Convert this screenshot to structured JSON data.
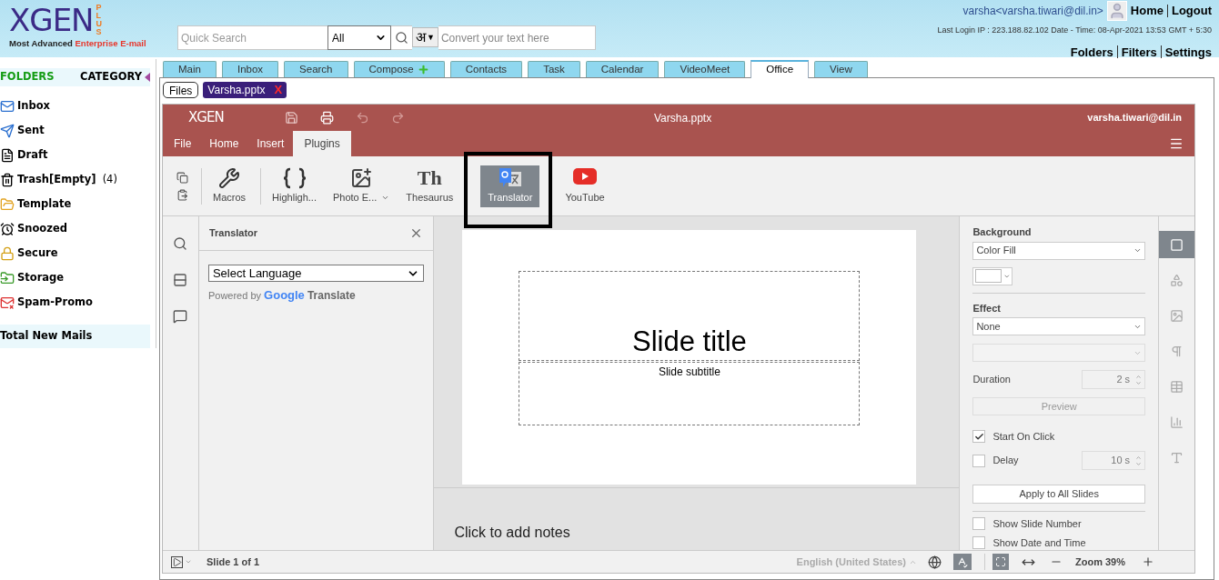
{
  "logo": {
    "name": "XGEN",
    "suffix": "PLUS",
    "tagline": "Most Advanced",
    "tagline_accent": "Enterprise E-mail"
  },
  "search": {
    "placeholder": "Quick Search",
    "scope": "All",
    "script_key": "अ",
    "script_caret": "▼",
    "convert_placeholder": "Convert your text here"
  },
  "user": {
    "identity": "varsha<varsha.tiwari@dil.in>",
    "links": [
      "Home",
      "Logout"
    ],
    "last_login": "Last Login IP : 223.188.82.102 Date - Time: 08-Apr-2021 13:53 GMT + 5:30",
    "nav": [
      "Folders",
      "Filters",
      "Settings"
    ]
  },
  "sidebar": {
    "folders_label": "FOLDERS",
    "category_label": "CATEGORY",
    "items": [
      {
        "kind": "inbox",
        "label": "Inbox"
      },
      {
        "kind": "sent",
        "label": "Sent"
      },
      {
        "kind": "draft",
        "label": "Draft"
      },
      {
        "kind": "trash",
        "label": "Trash[Empty]",
        "count": "(4)"
      },
      {
        "kind": "template",
        "label": "Template"
      },
      {
        "kind": "snoozed",
        "label": "Snoozed"
      },
      {
        "kind": "secure",
        "label": "Secure"
      },
      {
        "kind": "storage",
        "label": "Storage"
      },
      {
        "kind": "spam",
        "label": "Spam-Promo"
      }
    ],
    "total": "Total New Mails"
  },
  "tabs": [
    {
      "label": "Main",
      "selected": false
    },
    {
      "label": "Inbox",
      "selected": false
    },
    {
      "label": "Search",
      "selected": false
    },
    {
      "label": "Compose",
      "selected": false,
      "add": true
    },
    {
      "label": "Contacts",
      "selected": false
    },
    {
      "label": "Task",
      "selected": false
    },
    {
      "label": "Calendar",
      "selected": false
    },
    {
      "label": "VideoMeet",
      "selected": false
    },
    {
      "label": "Office",
      "selected": true
    },
    {
      "label": "View",
      "selected": false
    }
  ],
  "files": {
    "button": "Files",
    "open_file": "Varsha.pptx",
    "close": "X"
  },
  "editor": {
    "logo": "XGEN",
    "title": "Varsha.pptx",
    "user": "varsha.tiwari@dil.in",
    "menu": [
      {
        "label": "File",
        "selected": false
      },
      {
        "label": "Home",
        "selected": false
      },
      {
        "label": "Insert",
        "selected": false
      },
      {
        "label": "Plugins",
        "selected": true
      }
    ],
    "plugins": [
      {
        "kind": "macros",
        "label": "Macros",
        "selected": false
      },
      {
        "kind": "highlight",
        "label": "Highligh...",
        "selected": false
      },
      {
        "kind": "photo",
        "label": "Photo E...",
        "selected": false,
        "dropdown": true
      },
      {
        "kind": "thesaurus",
        "label": "Thesaurus",
        "glyph": "Th",
        "selected": false
      },
      {
        "kind": "translator",
        "label": "Translator",
        "selected": true,
        "highlighted": true
      },
      {
        "kind": "youtube",
        "label": "YouTube",
        "selected": false
      }
    ],
    "translator": {
      "title": "Translator",
      "language": "Select Language",
      "powered": "Powered by",
      "brand": "Google",
      "service": "Translate"
    },
    "slide": {
      "title": "Slide title",
      "subtitle": "Slide subtitle",
      "notes": "Click to add notes"
    },
    "panel": {
      "background_label": "Background",
      "fill": "Color Fill",
      "effect_label": "Effect",
      "effect": "None",
      "duration_label": "Duration",
      "duration": "2 s",
      "preview": "Preview",
      "options": [
        {
          "label": "Start On Click",
          "checked": true
        },
        {
          "label": "Delay",
          "checked": false,
          "value": "10 s"
        }
      ],
      "apply": "Apply to All Slides",
      "toggles": [
        {
          "label": "Show Slide Number",
          "checked": false
        },
        {
          "label": "Show Date and Time",
          "checked": false
        }
      ]
    },
    "side_tabs": [
      {
        "kind": "slide",
        "selected": true
      },
      {
        "kind": "shape",
        "selected": false
      },
      {
        "kind": "image",
        "selected": false
      },
      {
        "kind": "paragraph",
        "selected": false
      },
      {
        "kind": "table",
        "selected": false
      },
      {
        "kind": "chart",
        "selected": false
      },
      {
        "kind": "textart",
        "selected": false
      }
    ],
    "status": {
      "slide": "Slide 1 of 1",
      "language": "English (United States)",
      "zoom": "Zoom 39%"
    }
  }
}
